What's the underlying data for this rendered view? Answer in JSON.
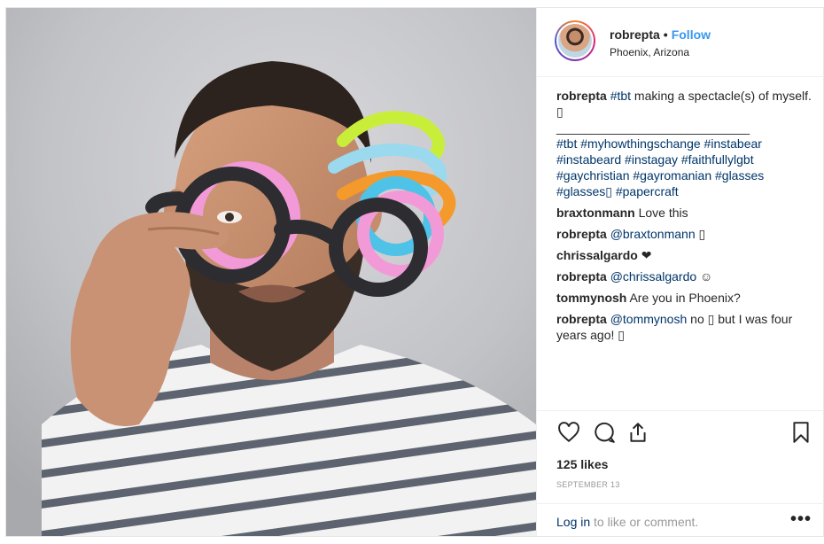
{
  "post": {
    "username": "robrepta",
    "follow_label": "Follow",
    "location": "Phoenix, Arizona",
    "separator": "•"
  },
  "caption": {
    "username": "robrepta",
    "tag1": "#tbt",
    "text1": " making a spectacle(s) of myself. ",
    "emoji1": "▯",
    "divider": "____________________________",
    "tags_line1": "#tbt #myhowthingschange #instabear",
    "tags_line2": "#instabeard #instagay #faithfullylgbt",
    "tags_line3": "#gaychristian #gayromanian #glasses",
    "tags_line4a": "#glasses▯",
    "tags_line4b": " #papercraft"
  },
  "comments": [
    {
      "user": "braxtonmann",
      "mention": "",
      "text": "Love this"
    },
    {
      "user": "robrepta",
      "mention": "@braxtonmann",
      "text": " ▯"
    },
    {
      "user": "chrissalgardo",
      "mention": "",
      "text": "❤"
    },
    {
      "user": "robrepta",
      "mention": "@chrissalgardo",
      "text": " ☺"
    },
    {
      "user": "tommynosh",
      "mention": "",
      "text": "Are you in Phoenix?"
    },
    {
      "user": "robrepta",
      "mention": "@tommynosh",
      "text": " no ▯ but I was four years ago! ▯"
    }
  ],
  "actions": {
    "icons": [
      "heart-icon",
      "comment-icon",
      "share-icon",
      "bookmark-icon"
    ],
    "likes": "125 likes",
    "date": "SEPTEMBER 13",
    "login_link": "Log in",
    "login_rest": " to like or comment.",
    "more": "•••"
  },
  "colors": {
    "link": "#003569",
    "follow": "#3897f0",
    "muted": "#999999",
    "text": "#262626"
  }
}
